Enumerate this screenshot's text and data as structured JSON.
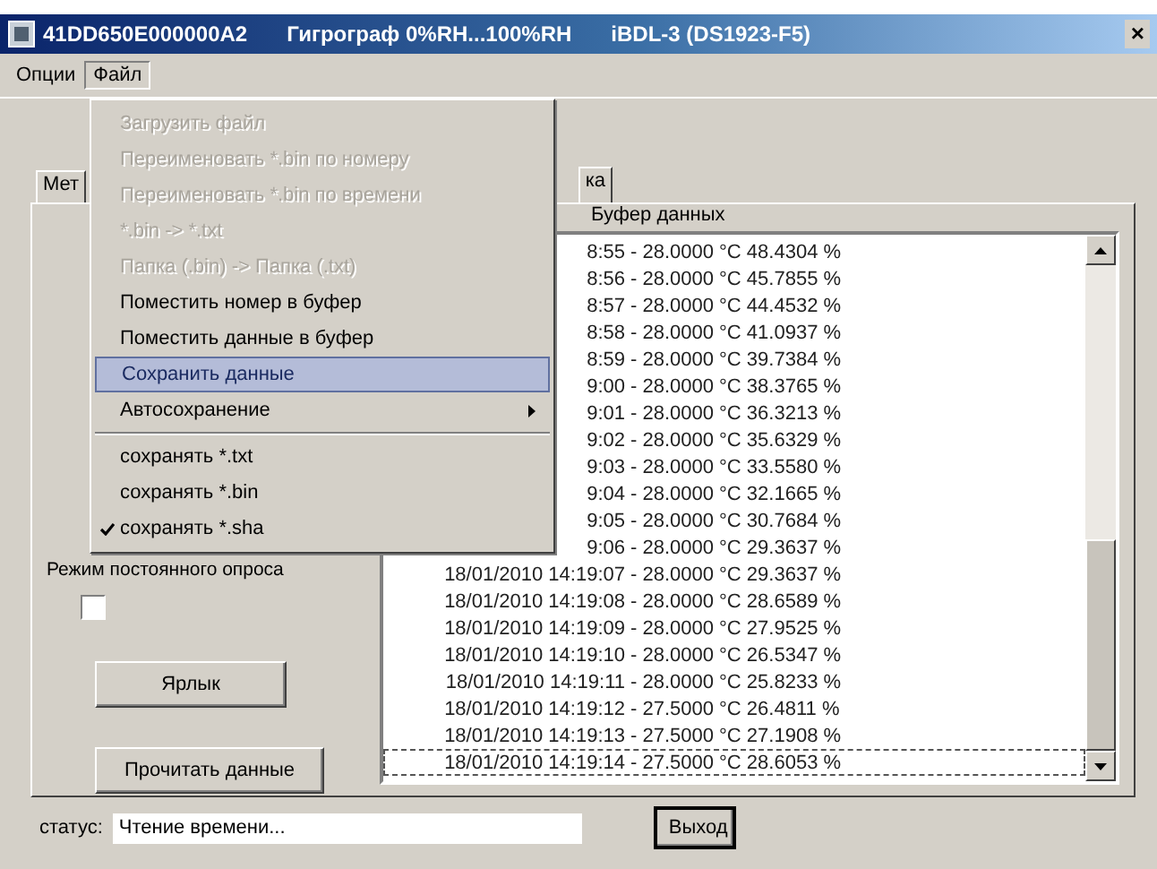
{
  "window": {
    "title_parts": [
      "41DD650E000000A2",
      "Гигрограф 0%RH...100%RH",
      "iBDL-3 (DS1923-F5)"
    ],
    "close": "×"
  },
  "menubar": [
    {
      "label": "Опции",
      "selected": false
    },
    {
      "label": "Файл",
      "selected": true
    }
  ],
  "file_menu": [
    {
      "kind": "item",
      "label": "Загрузить файл",
      "disabled": true,
      "selected": false,
      "checked": false
    },
    {
      "kind": "item",
      "label": "Переименовать *.bin по номеру",
      "disabled": true,
      "selected": false,
      "checked": false
    },
    {
      "kind": "item",
      "label": "Переименовать *.bin по времени",
      "disabled": true,
      "selected": false,
      "checked": false
    },
    {
      "kind": "item",
      "label": "*.bin -> *.txt",
      "disabled": true,
      "selected": false,
      "checked": false
    },
    {
      "kind": "item",
      "label": "Папка (.bin) -> Папка (.txt)",
      "disabled": true,
      "selected": false,
      "checked": false
    },
    {
      "kind": "item",
      "label": "Поместить номер в буфер",
      "disabled": false,
      "selected": false,
      "checked": false
    },
    {
      "kind": "item",
      "label": "Поместить данные в буфер",
      "disabled": false,
      "selected": false,
      "checked": false
    },
    {
      "kind": "item",
      "label": "Сохранить данные",
      "disabled": false,
      "selected": true,
      "checked": false
    },
    {
      "kind": "submenu",
      "label": "Автосохранение",
      "disabled": false,
      "selected": false,
      "checked": false
    },
    {
      "kind": "separator"
    },
    {
      "kind": "item",
      "label": "сохранять *.txt",
      "disabled": false,
      "selected": false,
      "checked": false
    },
    {
      "kind": "item",
      "label": "сохранять *.bin",
      "disabled": false,
      "selected": false,
      "checked": false
    },
    {
      "kind": "item",
      "label": "сохранять *.sha",
      "disabled": false,
      "selected": false,
      "checked": true
    }
  ],
  "tabs": [
    {
      "label": "Мет",
      "selected": false
    },
    {
      "label": "ка",
      "selected": true
    }
  ],
  "polling": {
    "label": "Режим постоянного опроса",
    "checked": false
  },
  "buttons": {
    "shortcut": "Ярлык",
    "read": "Прочитать данные",
    "exit": "Выход"
  },
  "buffer": {
    "title": "Буфер данных",
    "rows": [
      {
        "time": "8:55",
        "reading": "- 28.0000 °C 48.4304 %",
        "focused": false
      },
      {
        "time": "8:56",
        "reading": "- 28.0000 °C 45.7855 %",
        "focused": false
      },
      {
        "time": "8:57",
        "reading": "- 28.0000 °C 44.4532 %",
        "focused": false
      },
      {
        "time": "8:58",
        "reading": "- 28.0000 °C 41.0937 %",
        "focused": false
      },
      {
        "time": "8:59",
        "reading": "- 28.0000 °C 39.7384 %",
        "focused": false
      },
      {
        "time": "9:00",
        "reading": "- 28.0000 °C 38.3765 %",
        "focused": false
      },
      {
        "time": "9:01",
        "reading": "- 28.0000 °C 36.3213 %",
        "focused": false
      },
      {
        "time": "9:02",
        "reading": "- 28.0000 °C 35.6329 %",
        "focused": false
      },
      {
        "time": "9:03",
        "reading": "- 28.0000 °C 33.5580 %",
        "focused": false
      },
      {
        "time": "9:04",
        "reading": "- 28.0000 °C 32.1665 %",
        "focused": false
      },
      {
        "time": "9:05",
        "reading": "- 28.0000 °C 30.7684 %",
        "focused": false
      },
      {
        "time": "9:06",
        "reading": "- 28.0000 °C 29.3637 %",
        "focused": false
      },
      {
        "time": "18/01/2010 14:19:07",
        "reading": "- 28.0000 °C 29.3637 %",
        "focused": false
      },
      {
        "time": "18/01/2010 14:19:08",
        "reading": "- 28.0000 °C 28.6589 %",
        "focused": false
      },
      {
        "time": "18/01/2010 14:19:09",
        "reading": "- 28.0000 °C 27.9525 %",
        "focused": false
      },
      {
        "time": "18/01/2010 14:19:10",
        "reading": "- 28.0000 °C 26.5347 %",
        "focused": false
      },
      {
        "time": "18/01/2010 14:19:11",
        "reading": "- 28.0000 °C 25.8233 %",
        "focused": false
      },
      {
        "time": "18/01/2010 14:19:12",
        "reading": "- 27.5000 °C 26.4811 %",
        "focused": false
      },
      {
        "time": "18/01/2010 14:19:13",
        "reading": "- 27.5000 °C 27.1908 %",
        "focused": false
      },
      {
        "time": "18/01/2010 14:19:14",
        "reading": "- 27.5000 °C 28.6053 %",
        "focused": true
      }
    ]
  },
  "status": {
    "label": "статус:",
    "value": "Чтение времени..."
  }
}
